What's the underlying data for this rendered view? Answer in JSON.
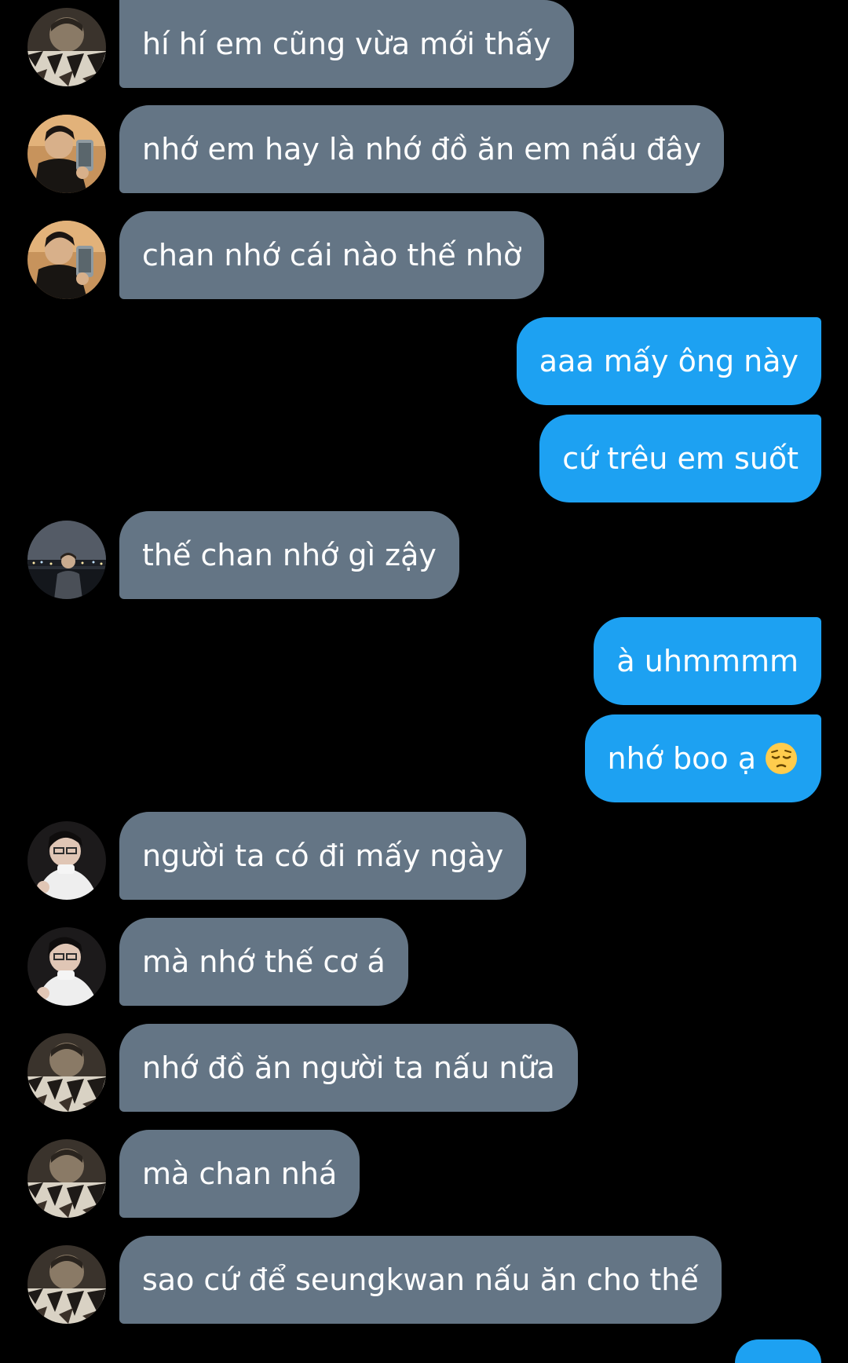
{
  "chat": {
    "colors": {
      "background": "#000000",
      "incoming_bubble": "#647585",
      "outgoing_bubble": "#1da1f2",
      "text": "#ffffff"
    },
    "messages": [
      {
        "direction": "incoming",
        "sender_avatar": "avatar-striped-blanket",
        "text": "hí hí em cũng vừa mới thấy"
      },
      {
        "direction": "incoming",
        "sender_avatar": "avatar-phone-selfie",
        "text": "nhớ em hay là nhớ đồ ăn em nấu đây"
      },
      {
        "direction": "incoming",
        "sender_avatar": "avatar-phone-selfie",
        "text": "chan nhớ cái nào thế nhờ"
      },
      {
        "direction": "outgoing",
        "text": "aaa mấy ông này"
      },
      {
        "direction": "outgoing",
        "text": "cứ trêu em suốt"
      },
      {
        "direction": "incoming",
        "sender_avatar": "avatar-night-city",
        "text": "thế chan nhớ gì zậy"
      },
      {
        "direction": "outgoing",
        "text": "à uhmmmm"
      },
      {
        "direction": "outgoing",
        "text": "nhớ boo ạ",
        "emoji": "pensive-face-emoji"
      },
      {
        "direction": "incoming",
        "sender_avatar": "avatar-white-turtleneck",
        "text": "người ta có đi mấy ngày"
      },
      {
        "direction": "incoming",
        "sender_avatar": "avatar-white-turtleneck",
        "text": "mà nhớ thế cơ á"
      },
      {
        "direction": "incoming",
        "sender_avatar": "avatar-striped-blanket",
        "text": "nhớ đồ ăn người ta nấu nữa"
      },
      {
        "direction": "incoming",
        "sender_avatar": "avatar-striped-blanket",
        "text": "mà chan nhá"
      },
      {
        "direction": "incoming",
        "sender_avatar": "avatar-striped-blanket",
        "text": "sao cứ để seungkwan nấu ăn cho thế"
      }
    ]
  }
}
